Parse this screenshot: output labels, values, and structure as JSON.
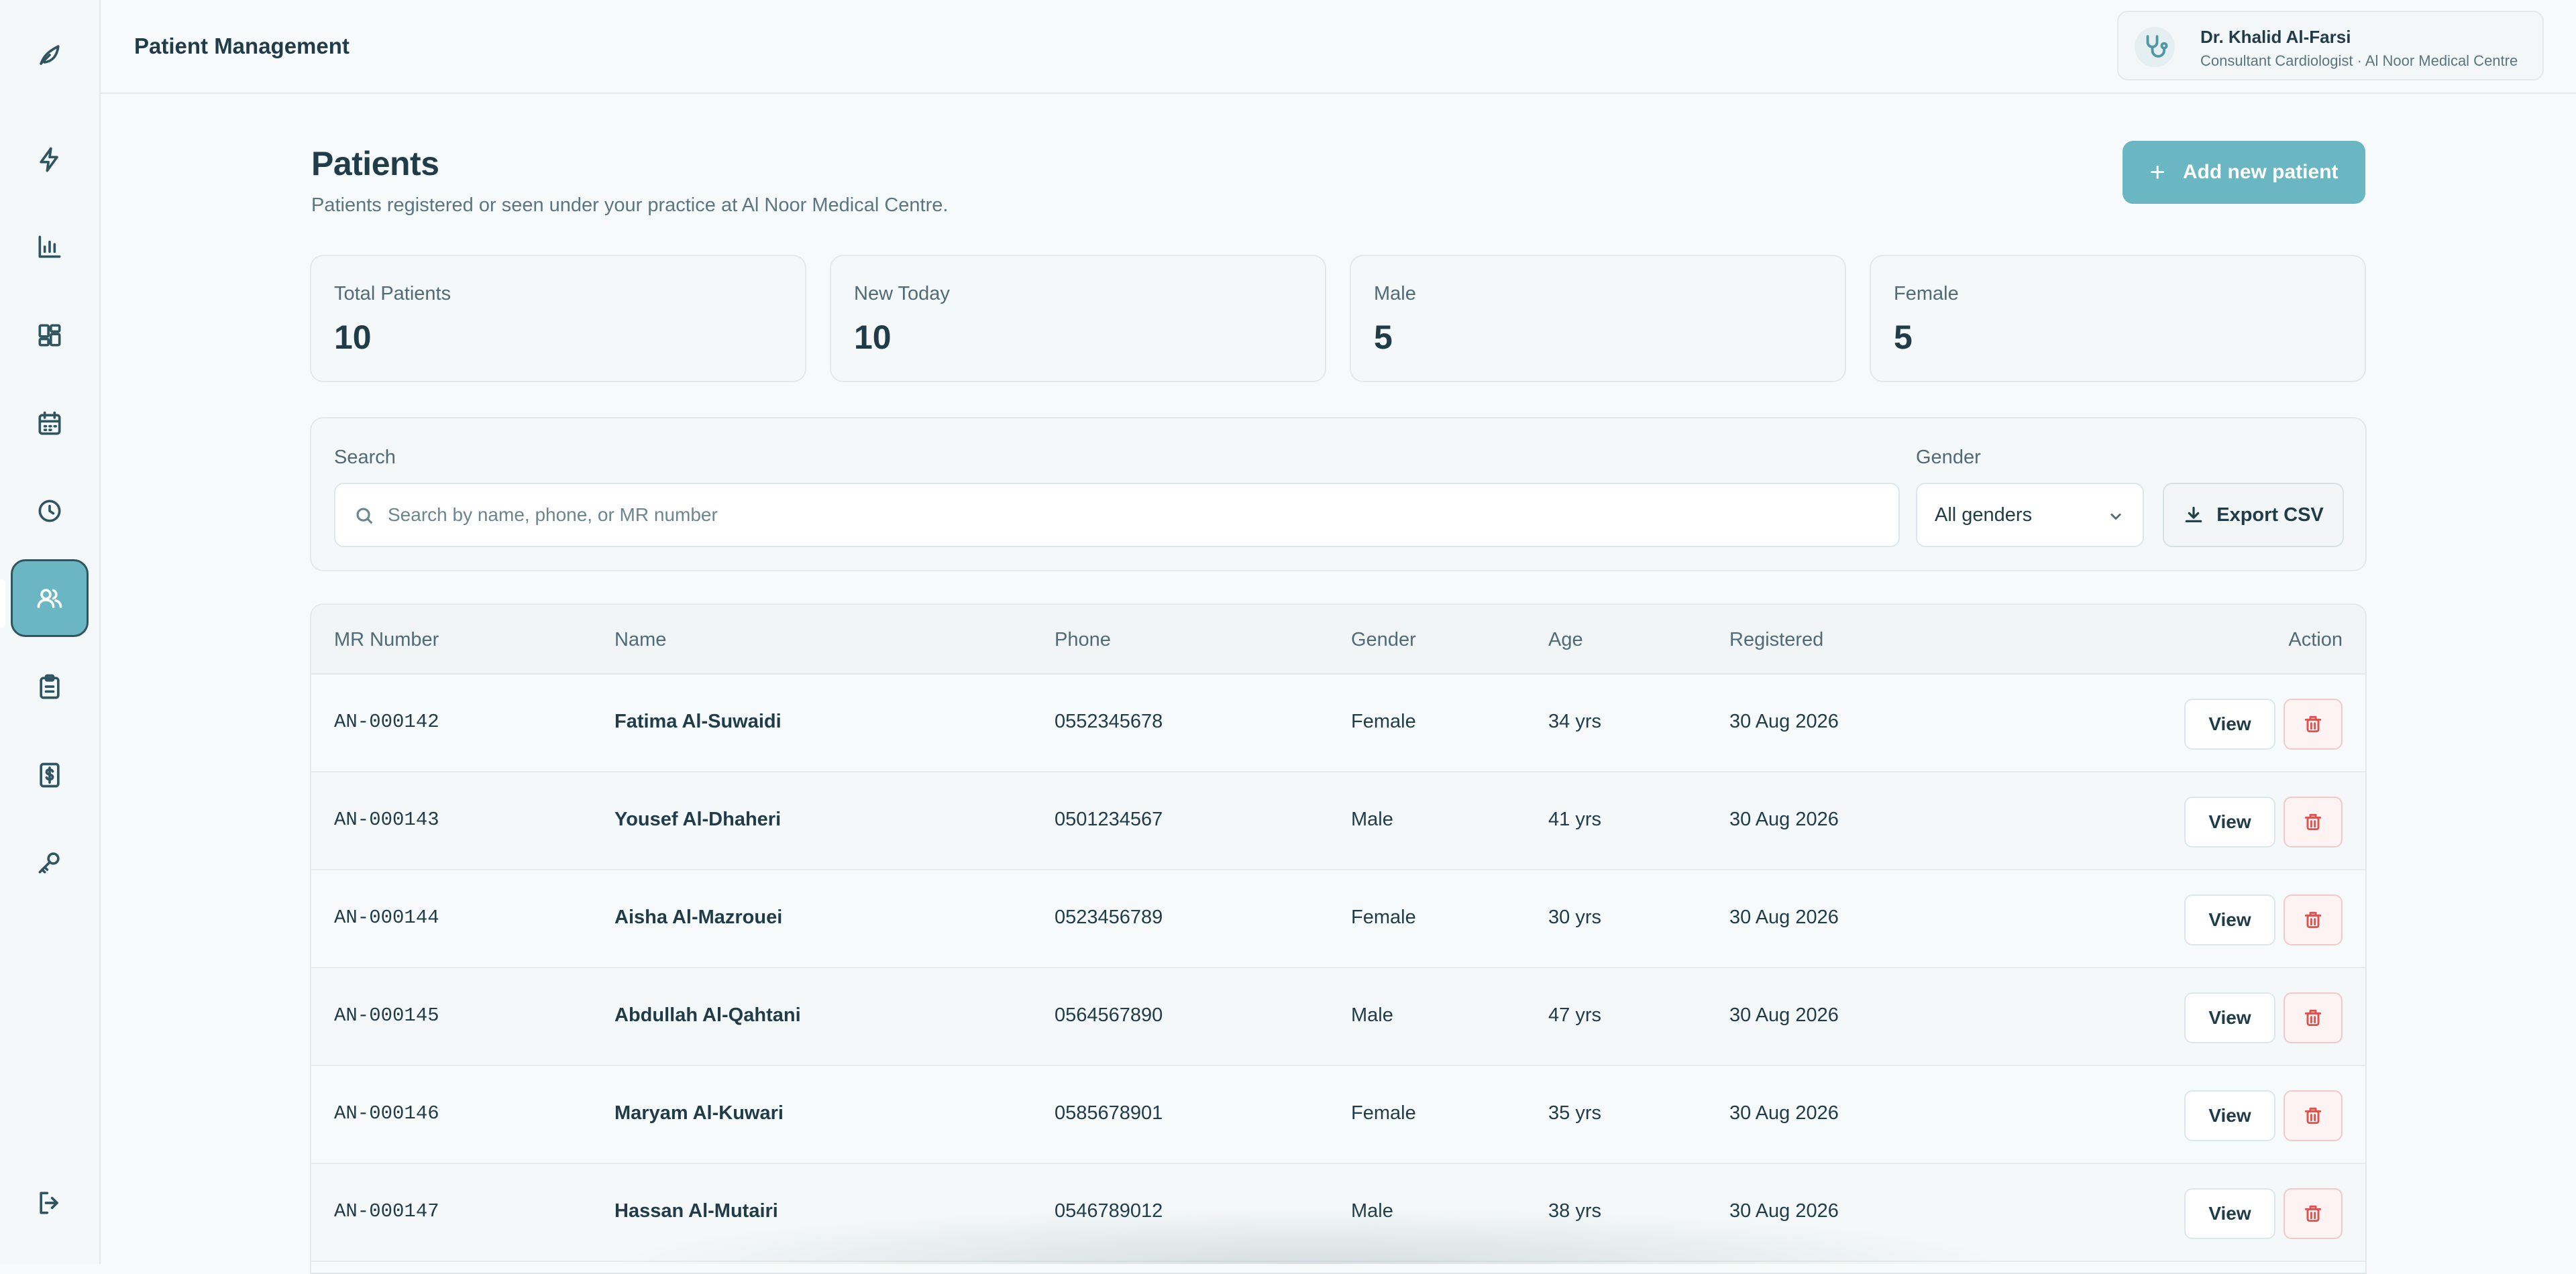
{
  "app": {
    "page_title": "Patient Management"
  },
  "sidebar": {
    "items": [
      {
        "icon": "leaf-logo-icon"
      },
      {
        "icon": "lightning-icon"
      },
      {
        "icon": "bar-chart-icon"
      },
      {
        "icon": "dashboard-grid-icon"
      },
      {
        "icon": "calendar-icon"
      },
      {
        "icon": "clock-icon"
      },
      {
        "icon": "users-icon",
        "active": true
      },
      {
        "icon": "clipboard-icon"
      },
      {
        "icon": "billing-dollar-icon"
      },
      {
        "icon": "key-icon"
      },
      {
        "icon": "logout-icon"
      }
    ]
  },
  "user": {
    "name": "Dr. Khalid Al-Farsi",
    "role": "Consultant Cardiologist · Al Noor Medical Centre",
    "avatar_icon": "stethoscope-icon"
  },
  "header": {
    "title": "Patients",
    "subtitle": "Patients registered or seen under your practice at Al Noor Medical Centre.",
    "add_button": "Add new patient"
  },
  "stats": [
    {
      "label": "Total Patients",
      "value": "10"
    },
    {
      "label": "New Today",
      "value": "10"
    },
    {
      "label": "Male",
      "value": "5"
    },
    {
      "label": "Female",
      "value": "5"
    }
  ],
  "filters": {
    "search_label": "Search",
    "search_placeholder": "Search by name, phone, or MR number",
    "search_value": "",
    "gender_label": "Gender",
    "gender_selected": "All genders",
    "export_label": "Export CSV"
  },
  "table": {
    "columns": [
      "MR Number",
      "Name",
      "Phone",
      "Gender",
      "Age",
      "Registered",
      "Action"
    ],
    "view_label": "View",
    "rows": [
      {
        "mr": "AN-000142",
        "name": "Fatima Al-Suwaidi",
        "phone": "0552345678",
        "gender": "Female",
        "age": "34 yrs",
        "registered": "30 Aug 2026"
      },
      {
        "mr": "AN-000143",
        "name": "Yousef Al-Dhaheri",
        "phone": "0501234567",
        "gender": "Male",
        "age": "41 yrs",
        "registered": "30 Aug 2026"
      },
      {
        "mr": "AN-000144",
        "name": "Aisha Al-Mazrouei",
        "phone": "0523456789",
        "gender": "Female",
        "age": "30 yrs",
        "registered": "30 Aug 2026"
      },
      {
        "mr": "AN-000145",
        "name": "Abdullah Al-Qahtani",
        "phone": "0564567890",
        "gender": "Male",
        "age": "47 yrs",
        "registered": "30 Aug 2026"
      },
      {
        "mr": "AN-000146",
        "name": "Maryam Al-Kuwari",
        "phone": "0585678901",
        "gender": "Female",
        "age": "35 yrs",
        "registered": "30 Aug 2026"
      },
      {
        "mr": "AN-000147",
        "name": "Hassan Al-Mutairi",
        "phone": "0546789012",
        "gender": "Male",
        "age": "38 yrs",
        "registered": "30 Aug 2026"
      }
    ]
  },
  "colors": {
    "accent": "#6ab6c2",
    "text": "#1f3c48",
    "danger": "#d9534f"
  }
}
